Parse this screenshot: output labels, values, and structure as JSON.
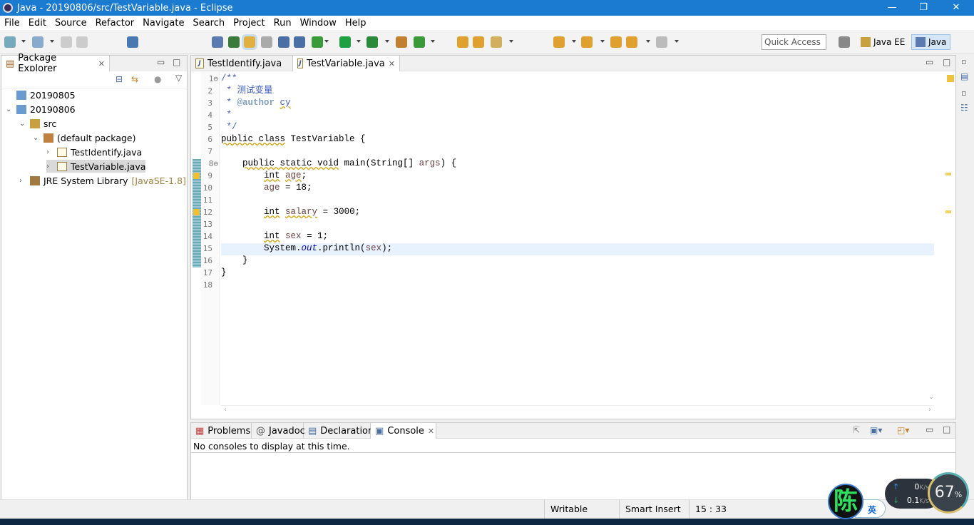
{
  "window": {
    "title": "Java - 20190806/src/TestVariable.java - Eclipse",
    "minimize": "—",
    "maximize": "❐",
    "close": "✕"
  },
  "menu": [
    "File",
    "Edit",
    "Source",
    "Refactor",
    "Navigate",
    "Search",
    "Project",
    "Run",
    "Window",
    "Help"
  ],
  "toolbar": {
    "quick_access_placeholder": "Quick Access",
    "perspectives": [
      {
        "label": "Java EE",
        "active": false
      },
      {
        "label": "Java",
        "active": true
      }
    ]
  },
  "package_explorer": {
    "title": "Package Explorer",
    "tree": [
      {
        "label": "20190805",
        "depth": 0,
        "expanded": null,
        "icon": "project-icon"
      },
      {
        "label": "20190806",
        "depth": 0,
        "expanded": true,
        "icon": "project-icon"
      },
      {
        "label": "src",
        "depth": 1,
        "expanded": true,
        "icon": "source-folder-icon"
      },
      {
        "label": "(default package)",
        "depth": 2,
        "expanded": true,
        "icon": "package-icon"
      },
      {
        "label": "TestIdentify.java",
        "depth": 3,
        "expanded": false,
        "icon": "java-file-icon"
      },
      {
        "label": "TestVariable.java",
        "depth": 3,
        "expanded": false,
        "icon": "java-file-icon",
        "selected": true
      },
      {
        "label": "JRE System Library",
        "suffix": "[JavaSE-1.8]",
        "depth": 1,
        "expanded": false,
        "icon": "library-icon"
      }
    ]
  },
  "editor": {
    "tabs": [
      {
        "label": "TestIdentify.java",
        "active": false
      },
      {
        "label": "TestVariable.java",
        "active": true
      }
    ],
    "current_line": 15,
    "lines": [
      [
        [
          "cm",
          "/**"
        ]
      ],
      [
        [
          "cm",
          " * 测试变量"
        ]
      ],
      [
        [
          "cm",
          " * "
        ],
        [
          "tag",
          "@author"
        ],
        [
          "cm",
          " "
        ],
        [
          "cmw",
          "cy"
        ]
      ],
      [
        [
          "cm",
          " *"
        ]
      ],
      [
        [
          "cm",
          " */"
        ]
      ],
      [
        [
          "kw",
          "public class"
        ],
        [
          "pl",
          " TestVariable {"
        ]
      ],
      [],
      [
        [
          "pl",
          "    "
        ],
        [
          "kw",
          "public static void"
        ],
        [
          "pl",
          " main(String[] "
        ],
        [
          "var",
          "args"
        ],
        [
          "pl",
          ") {"
        ]
      ],
      [
        [
          "pl",
          "        "
        ],
        [
          "kw",
          "int"
        ],
        [
          "pl",
          " "
        ],
        [
          "varw",
          "age"
        ],
        [
          "pl",
          ";"
        ]
      ],
      [
        [
          "pl",
          "        "
        ],
        [
          "var",
          "age"
        ],
        [
          "pl",
          " = 18;"
        ]
      ],
      [],
      [
        [
          "pl",
          "        "
        ],
        [
          "kw",
          "int"
        ],
        [
          "pl",
          " "
        ],
        [
          "varw",
          "salary"
        ],
        [
          "pl",
          " = 3000;"
        ]
      ],
      [],
      [
        [
          "pl",
          "        "
        ],
        [
          "kw",
          "int"
        ],
        [
          "pl",
          " "
        ],
        [
          "var",
          "sex"
        ],
        [
          "pl",
          " = 1;"
        ]
      ],
      [
        [
          "pl",
          "        System."
        ],
        [
          "fld",
          "out"
        ],
        [
          "pl",
          ".println("
        ],
        [
          "var",
          "sex"
        ],
        [
          "pl",
          ");"
        ]
      ],
      [
        [
          "pl",
          "    }"
        ]
      ],
      [
        [
          "pl",
          "}"
        ]
      ],
      []
    ]
  },
  "bottom": {
    "tabs": [
      {
        "label": "Problems",
        "active": false
      },
      {
        "label": "Javadoc",
        "active": false
      },
      {
        "label": "Declaration",
        "active": false
      },
      {
        "label": "Console",
        "active": true
      }
    ],
    "message": "No consoles to display at this time."
  },
  "status": {
    "writable": "Writable",
    "insert_mode": "Smart Insert",
    "position": "15 : 33"
  },
  "overlay": {
    "avatar_char": "陈",
    "ime": "英",
    "upload": "0",
    "download": "0.1",
    "unit": "K/s",
    "percent": "67",
    "percent_sign": "%"
  }
}
